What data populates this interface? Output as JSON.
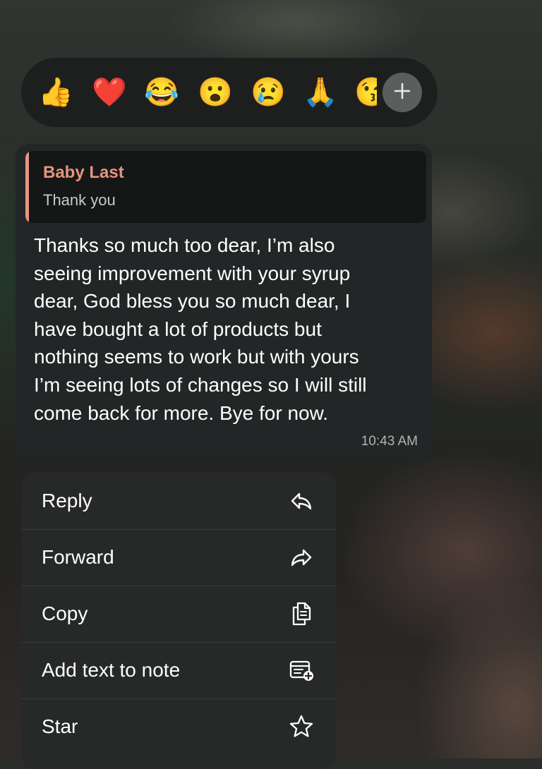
{
  "reactions": {
    "emojis": [
      {
        "glyph": "👍",
        "icon": "thumbs-up-icon"
      },
      {
        "glyph": "❤️",
        "icon": "heart-icon"
      },
      {
        "glyph": "😂",
        "icon": "tears-of-joy-icon"
      },
      {
        "glyph": "😮",
        "icon": "surprised-face-icon"
      },
      {
        "glyph": "😢",
        "icon": "crying-face-icon"
      },
      {
        "glyph": "🙏",
        "icon": "folded-hands-icon"
      },
      {
        "glyph": "😘",
        "icon": "kiss-face-icon"
      }
    ],
    "more_icon": "plus-icon"
  },
  "message": {
    "quote_author": "Baby Last",
    "quote_text": "Thank you",
    "body": "Thanks so much too dear, I’m also\nseeing improvement with your syrup\ndear, God bless you so much dear, I\nhave bought a lot of products but\nnothing seems to work but with yours\nI’m seeing lots of changes so I will still\ncome back for more. Bye for now.",
    "time": "10:43 AM",
    "quote_accent_color": "#e7947f"
  },
  "menu": {
    "items": [
      {
        "label": "Reply",
        "icon": "reply-icon"
      },
      {
        "label": "Forward",
        "icon": "forward-icon"
      },
      {
        "label": "Copy",
        "icon": "copy-icon"
      },
      {
        "label": "Add text to note",
        "icon": "add-note-icon"
      },
      {
        "label": "Star",
        "icon": "star-icon"
      }
    ]
  }
}
